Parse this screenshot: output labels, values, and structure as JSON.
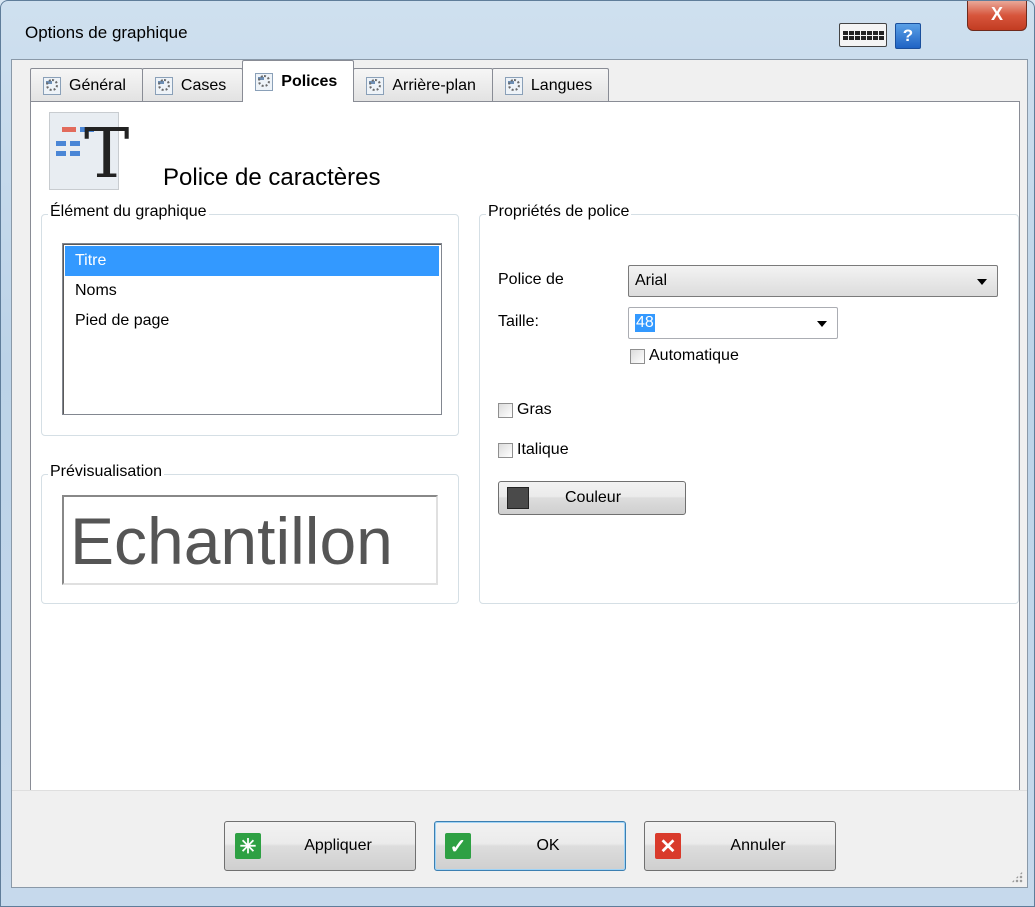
{
  "window": {
    "title": "Options de graphique",
    "close_label": "X",
    "help_label": "?"
  },
  "tabs": [
    {
      "label": "Général",
      "active": false
    },
    {
      "label": "Cases",
      "active": false
    },
    {
      "label": "Polices",
      "active": true
    },
    {
      "label": "Arrière-plan",
      "active": false
    },
    {
      "label": "Langues",
      "active": false
    }
  ],
  "header": {
    "title": "Police de caractères"
  },
  "element_group": {
    "legend": "Élément du graphique",
    "items": [
      "Titre",
      "Noms",
      "Pied de page"
    ],
    "selected": "Titre"
  },
  "preview_group": {
    "legend": "Prévisualisation",
    "sample_text": "Echantillon",
    "sample_color": "#555555"
  },
  "font_props": {
    "legend": "Propriétés de police",
    "font_label": "Police de",
    "font_value": "Arial",
    "size_label": "Taille:",
    "size_value": "48",
    "auto_label": "Automatique",
    "auto_checked": false,
    "bold_label": "Gras",
    "bold_checked": false,
    "italic_label": "Italique",
    "italic_checked": false,
    "color_button_label": "Couleur",
    "color_value": "#4a4a4a"
  },
  "footer": {
    "apply_label": "Appliquer",
    "ok_label": "OK",
    "cancel_label": "Annuler"
  },
  "colors": {
    "selection": "#3399ff",
    "apply_icon": "#2ea043",
    "ok_icon": "#2ea043",
    "cancel_icon": "#d93a2b"
  }
}
